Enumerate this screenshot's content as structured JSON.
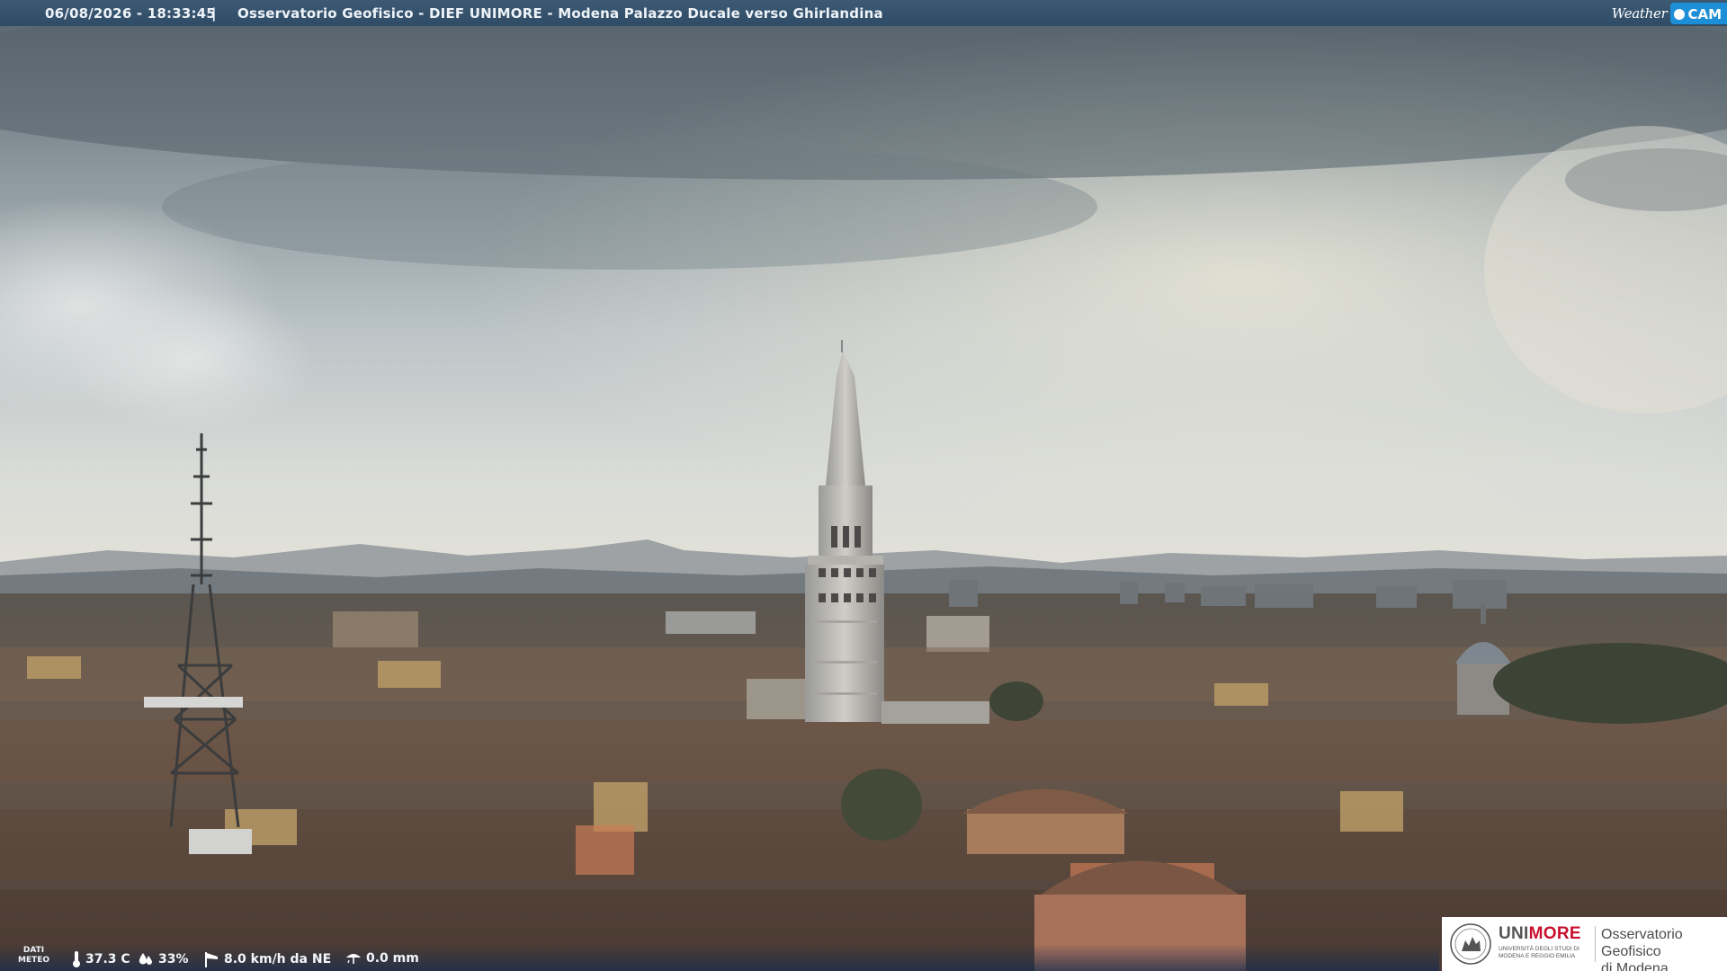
{
  "header": {
    "datetime": "06/08/2026 - 18:33:45",
    "separator": "|",
    "title": "Osservatorio Geofisico - DIEF UNIMORE - Modena Palazzo Ducale verso Ghirlandina"
  },
  "brand": {
    "weather": "Weather",
    "cam": "CAM",
    "accent": "#1d8fd6"
  },
  "meteo": {
    "label_line1": "DATI",
    "label_line2": "METEO",
    "temperature": "37.3 C",
    "humidity": "33%",
    "wind": "8.0 km/h da NE",
    "rain": "0.0 mm",
    "icons": [
      "thermometer-icon",
      "humidity-drop-icon",
      "wind-sock-icon",
      "rain-gauge-icon"
    ]
  },
  "logo": {
    "uni": "UNI",
    "more": "MORE",
    "university_line": "UNIVERSITÀ DEGLI STUDI DI MODENA E REGGIO EMILIA",
    "observatory_line1": "Osservatorio Geofisico",
    "observatory_line2": "di Modena",
    "brand_red": "#c8102e"
  },
  "scene": {
    "description_free": "",
    "sky_color": "#c9cfd3",
    "roof_color": "#6e5a4c"
  }
}
